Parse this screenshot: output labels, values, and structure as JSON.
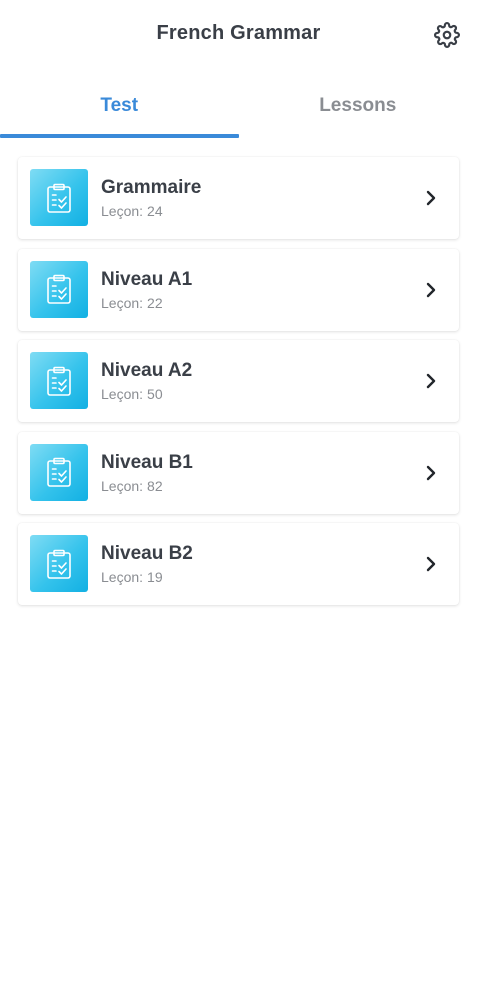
{
  "header": {
    "title": "French Grammar",
    "settings_icon": "gear-icon"
  },
  "tabs": [
    {
      "label": "Test",
      "active": true
    },
    {
      "label": "Lessons",
      "active": false
    }
  ],
  "colors": {
    "accent": "#3a8ad9",
    "title_text": "#3a3f47",
    "secondary_text": "#8a8d92",
    "icon_gradient_start": "#7fdcf4",
    "icon_gradient_end": "#12b0e3"
  },
  "list": {
    "item_icon": "clipboard-check-icon",
    "chevron_icon": "chevron-right-icon",
    "lesson_label": "Leçon:",
    "items": [
      {
        "title": "Grammaire",
        "count": "24"
      },
      {
        "title": "Niveau A1",
        "count": "22"
      },
      {
        "title": "Niveau A2",
        "count": "50"
      },
      {
        "title": "Niveau B1",
        "count": "82"
      },
      {
        "title": "Niveau B2",
        "count": "19"
      }
    ]
  }
}
